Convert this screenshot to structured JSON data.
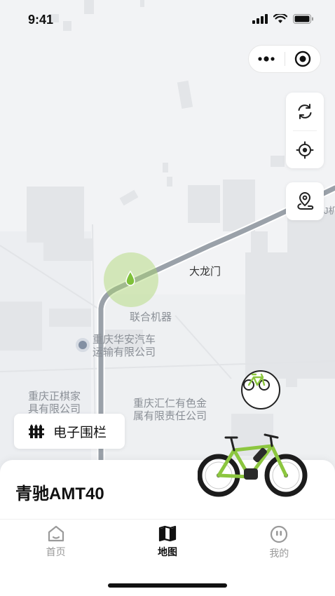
{
  "status_bar": {
    "time": "9:41"
  },
  "map": {
    "labels": {
      "dalongmen": "大龙门",
      "lianhe": "联合机器",
      "huaan_line1": "重庆华安汽车",
      "huaan_line2": "运输有限公司",
      "zhengqi_line1": "重庆正棋家",
      "zhengqi_line2": "具有限公司",
      "huiren_line1": "重庆汇仁有色金",
      "huiren_line2": "属有限责任公司",
      "edge": "J机"
    }
  },
  "fence_button": {
    "label": "电子围栏"
  },
  "vehicle_card": {
    "name": "青驰AMT40"
  },
  "tabbar": {
    "tabs": [
      {
        "label": "首页",
        "icon": "home-icon",
        "active": false
      },
      {
        "label": "地图",
        "icon": "map-icon",
        "active": true
      },
      {
        "label": "我的",
        "icon": "profile-icon",
        "active": false
      }
    ]
  },
  "colors": {
    "accent_green": "#8cc63f",
    "text_primary": "#111111",
    "text_muted": "#9a9a9a"
  }
}
